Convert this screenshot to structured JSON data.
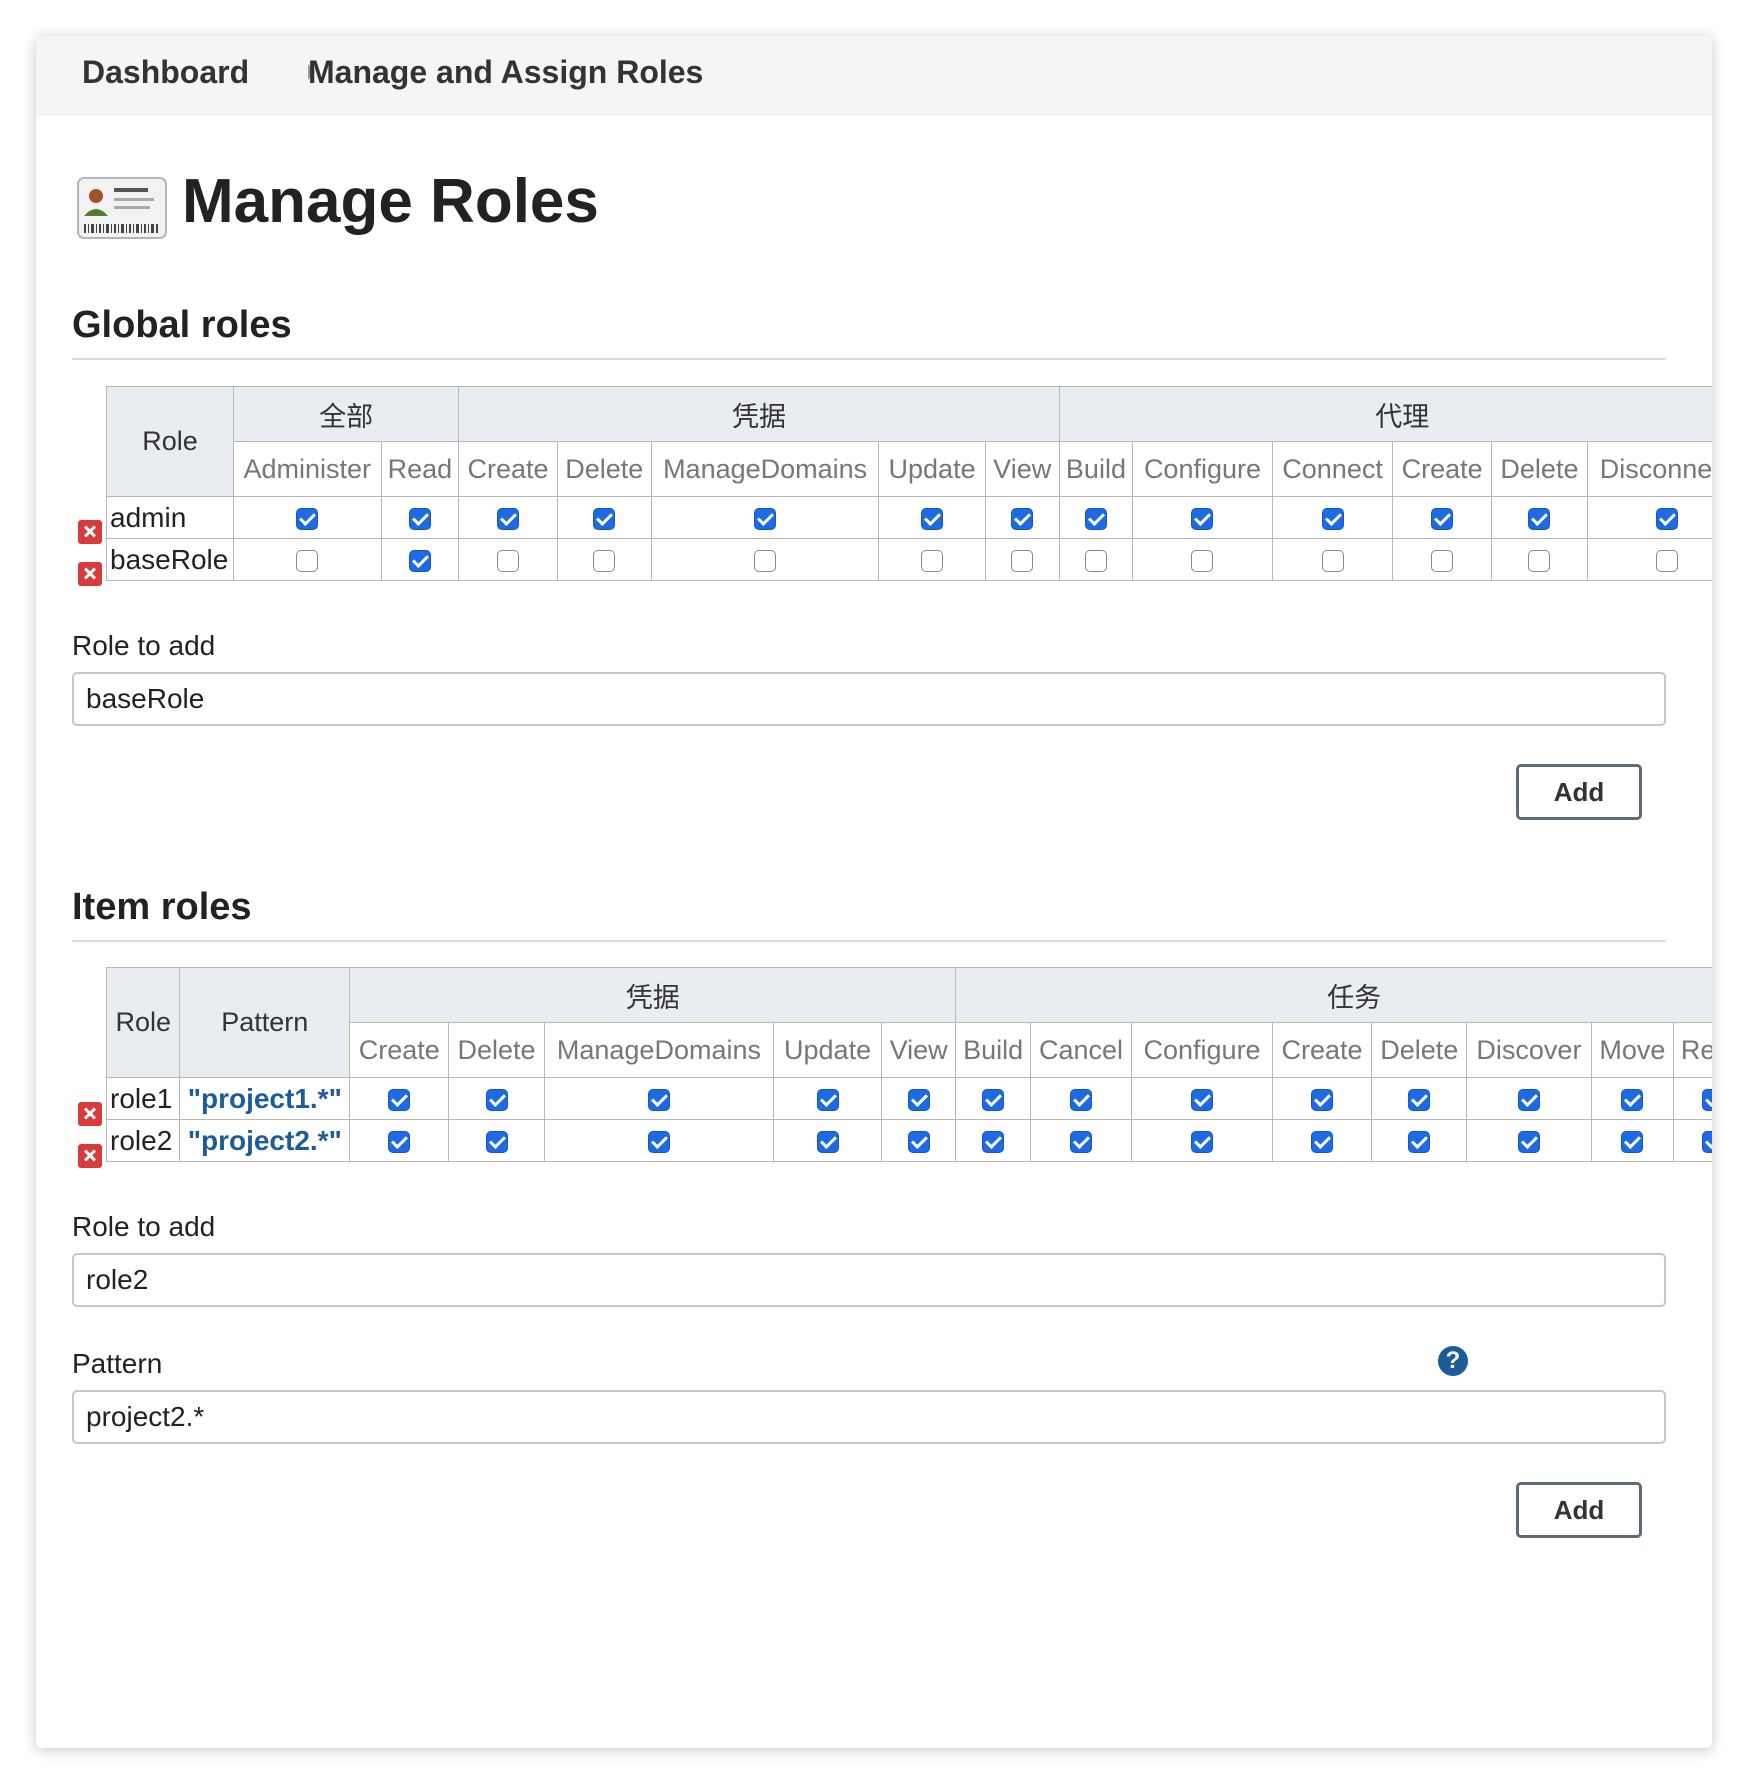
{
  "breadcrumb": {
    "items": [
      "Dashboard",
      "Manage and Assign Roles"
    ]
  },
  "page": {
    "title": "Manage Roles"
  },
  "global": {
    "section_title": "Global roles",
    "role_header": "Role",
    "groups": [
      {
        "name": "全部",
        "perms": [
          "Administer",
          "Read"
        ]
      },
      {
        "name": "凭据",
        "perms": [
          "Create",
          "Delete",
          "ManageDomains",
          "Update",
          "View"
        ]
      },
      {
        "name": "代理",
        "perms": [
          "Build",
          "Configure",
          "Connect",
          "Create",
          "Delete",
          "Disconnect"
        ]
      }
    ],
    "rows": [
      {
        "role": "admin",
        "checks": [
          true,
          true,
          true,
          true,
          true,
          true,
          true,
          true,
          true,
          true,
          true,
          true,
          true
        ]
      },
      {
        "role": "baseRole",
        "checks": [
          false,
          true,
          false,
          false,
          false,
          false,
          false,
          false,
          false,
          false,
          false,
          false,
          false
        ]
      }
    ],
    "add": {
      "label": "Role to add",
      "value": "baseRole",
      "button": "Add"
    }
  },
  "item": {
    "section_title": "Item roles",
    "role_header": "Role",
    "pattern_header": "Pattern",
    "groups": [
      {
        "name": "凭据",
        "perms": [
          "Create",
          "Delete",
          "ManageDomains",
          "Update",
          "View"
        ]
      },
      {
        "name": "任务",
        "perms": [
          "Build",
          "Cancel",
          "Configure",
          "Create",
          "Delete",
          "Discover",
          "Move",
          "Read"
        ]
      }
    ],
    "rows": [
      {
        "role": "role1",
        "pattern": "\"project1.*\"",
        "checks": [
          true,
          true,
          true,
          true,
          true,
          true,
          true,
          true,
          true,
          true,
          true,
          true,
          true
        ]
      },
      {
        "role": "role2",
        "pattern": "\"project2.*\"",
        "checks": [
          true,
          true,
          true,
          true,
          true,
          true,
          true,
          true,
          true,
          true,
          true,
          true,
          true
        ]
      }
    ],
    "add": {
      "label": "Role to add",
      "value": "role2",
      "pattern_label": "Pattern",
      "pattern_value": "project2.*",
      "button": "Add",
      "help": "?"
    }
  }
}
